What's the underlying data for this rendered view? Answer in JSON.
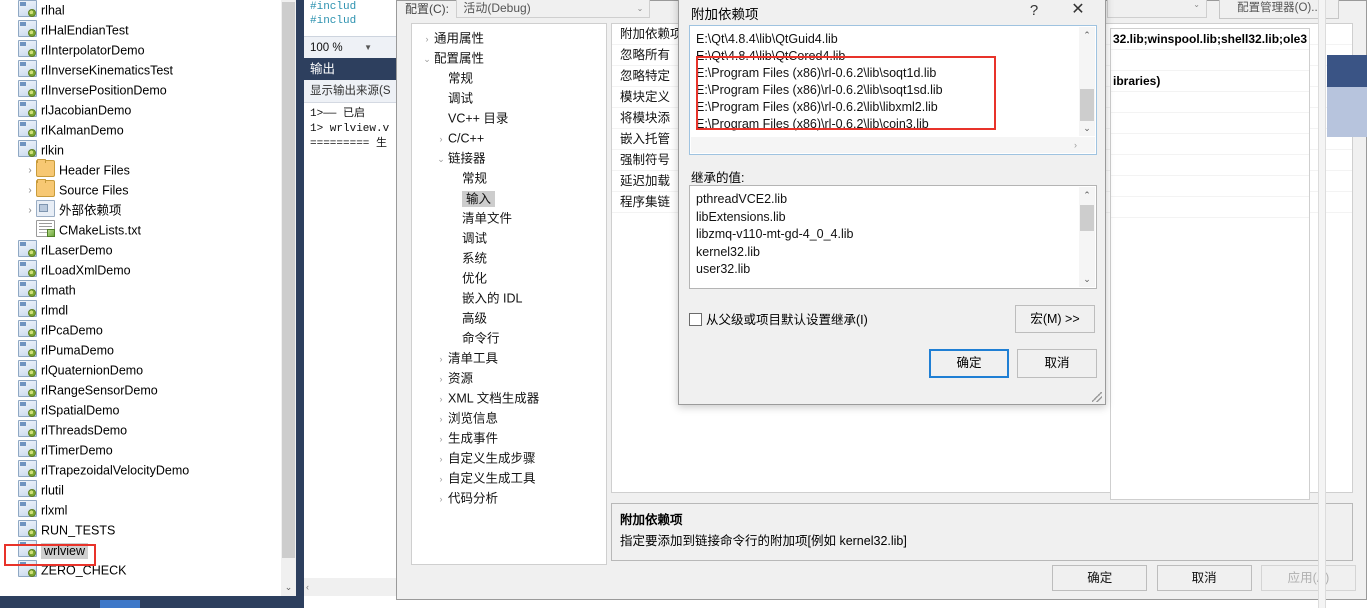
{
  "solution_explorer": {
    "items": [
      {
        "label": "rlhal",
        "icon": "project-icon",
        "indent": 1,
        "expander": "",
        "selected": false
      },
      {
        "label": "rlHalEndianTest",
        "icon": "project-icon",
        "indent": 1,
        "expander": "",
        "selected": false
      },
      {
        "label": "rlInterpolatorDemo",
        "icon": "project-icon",
        "indent": 1,
        "expander": "",
        "selected": false
      },
      {
        "label": "rlInverseKinematicsTest",
        "icon": "project-icon",
        "indent": 1,
        "expander": "",
        "selected": false
      },
      {
        "label": "rlInversePositionDemo",
        "icon": "project-icon",
        "indent": 1,
        "expander": "",
        "selected": false
      },
      {
        "label": "rlJacobianDemo",
        "icon": "project-icon",
        "indent": 1,
        "expander": "",
        "selected": false
      },
      {
        "label": "rlKalmanDemo",
        "icon": "project-icon",
        "indent": 1,
        "expander": "",
        "selected": false
      },
      {
        "label": "rlkin",
        "icon": "project-icon",
        "indent": 1,
        "expander": "",
        "selected": false
      },
      {
        "label": "Header Files",
        "icon": "folder-icon",
        "indent": 2,
        "expander": "›",
        "selected": false
      },
      {
        "label": "Source Files",
        "icon": "folder-icon",
        "indent": 2,
        "expander": "›",
        "selected": false
      },
      {
        "label": "外部依赖项",
        "icon": "external-dependencies-icon",
        "indent": 2,
        "expander": "›",
        "selected": false
      },
      {
        "label": "CMakeLists.txt",
        "icon": "text-file-icon",
        "indent": 2,
        "expander": "",
        "selected": false
      },
      {
        "label": "rlLaserDemo",
        "icon": "project-icon",
        "indent": 1,
        "expander": "",
        "selected": false
      },
      {
        "label": "rlLoadXmlDemo",
        "icon": "project-icon",
        "indent": 1,
        "expander": "",
        "selected": false
      },
      {
        "label": "rlmath",
        "icon": "project-icon",
        "indent": 1,
        "expander": "",
        "selected": false
      },
      {
        "label": "rlmdl",
        "icon": "project-icon",
        "indent": 1,
        "expander": "",
        "selected": false
      },
      {
        "label": "rlPcaDemo",
        "icon": "project-icon",
        "indent": 1,
        "expander": "",
        "selected": false
      },
      {
        "label": "rlPumaDemo",
        "icon": "project-icon",
        "indent": 1,
        "expander": "",
        "selected": false
      },
      {
        "label": "rlQuaternionDemo",
        "icon": "project-icon",
        "indent": 1,
        "expander": "",
        "selected": false
      },
      {
        "label": "rlRangeSensorDemo",
        "icon": "project-icon",
        "indent": 1,
        "expander": "",
        "selected": false
      },
      {
        "label": "rlSpatialDemo",
        "icon": "project-icon",
        "indent": 1,
        "expander": "",
        "selected": false
      },
      {
        "label": "rlThreadsDemo",
        "icon": "project-icon",
        "indent": 1,
        "expander": "",
        "selected": false
      },
      {
        "label": "rlTimerDemo",
        "icon": "project-icon",
        "indent": 1,
        "expander": "",
        "selected": false
      },
      {
        "label": "rlTrapezoidalVelocityDemo",
        "icon": "project-icon",
        "indent": 1,
        "expander": "",
        "selected": false
      },
      {
        "label": "rlutil",
        "icon": "project-icon",
        "indent": 1,
        "expander": "",
        "selected": false
      },
      {
        "label": "rlxml",
        "icon": "project-icon",
        "indent": 1,
        "expander": "",
        "selected": false
      },
      {
        "label": "RUN_TESTS",
        "icon": "project-icon",
        "indent": 1,
        "expander": "",
        "selected": false
      },
      {
        "label": "wrlview",
        "icon": "project-icon",
        "indent": 1,
        "expander": "",
        "selected": true
      },
      {
        "label": "ZERO_CHECK",
        "icon": "project-icon",
        "indent": 1,
        "expander": "",
        "selected": false
      }
    ],
    "scroll_down_glyph": "⌄"
  },
  "code_editor": {
    "lines": [
      "#includ",
      "#includ"
    ],
    "zoom_level": "100 %",
    "zoom_caret": "▼"
  },
  "output_window": {
    "title": "输出",
    "source_label": "显示输出来源(S",
    "lines": [
      "1>—— 已启",
      "1>  wrlview.v",
      "  =========  生"
    ],
    "hscroll_left_glyph": "‹"
  },
  "property_pages": {
    "config_label": "配置(C):",
    "config_value": "活动(Debug)",
    "platform_value": "",
    "config_manager_button": "配置管理器(O)...",
    "caret_glyph": "⌄",
    "tree": [
      {
        "label": "通用属性",
        "level": 0,
        "chev": "›",
        "selected": false
      },
      {
        "label": "配置属性",
        "level": 0,
        "chev": "⌄",
        "selected": false
      },
      {
        "label": "常规",
        "level": 1,
        "chev": "",
        "selected": false
      },
      {
        "label": "调试",
        "level": 1,
        "chev": "",
        "selected": false
      },
      {
        "label": "VC++ 目录",
        "level": 1,
        "chev": "",
        "selected": false
      },
      {
        "label": "C/C++",
        "level": 1,
        "chev": "›",
        "selected": false
      },
      {
        "label": "链接器",
        "level": 1,
        "chev": "⌄",
        "selected": false
      },
      {
        "label": "常规",
        "level": 2,
        "chev": "",
        "selected": false
      },
      {
        "label": "输入",
        "level": 2,
        "chev": "",
        "selected": true
      },
      {
        "label": "清单文件",
        "level": 2,
        "chev": "",
        "selected": false
      },
      {
        "label": "调试",
        "level": 2,
        "chev": "",
        "selected": false
      },
      {
        "label": "系统",
        "level": 2,
        "chev": "",
        "selected": false
      },
      {
        "label": "优化",
        "level": 2,
        "chev": "",
        "selected": false
      },
      {
        "label": "嵌入的 IDL",
        "level": 2,
        "chev": "",
        "selected": false
      },
      {
        "label": "高级",
        "level": 2,
        "chev": "",
        "selected": false
      },
      {
        "label": "命令行",
        "level": 2,
        "chev": "",
        "selected": false
      },
      {
        "label": "清单工具",
        "level": 1,
        "chev": "›",
        "selected": false
      },
      {
        "label": "资源",
        "level": 1,
        "chev": "›",
        "selected": false
      },
      {
        "label": "XML 文档生成器",
        "level": 1,
        "chev": "›",
        "selected": false
      },
      {
        "label": "浏览信息",
        "level": 1,
        "chev": "›",
        "selected": false
      },
      {
        "label": "生成事件",
        "level": 1,
        "chev": "›",
        "selected": false
      },
      {
        "label": "自定义生成步骤",
        "level": 1,
        "chev": "›",
        "selected": false
      },
      {
        "label": "自定义生成工具",
        "level": 1,
        "chev": "›",
        "selected": false
      },
      {
        "label": "代码分析",
        "level": 1,
        "chev": "›",
        "selected": false
      }
    ],
    "properties": [
      {
        "name": "附加依赖项",
        "value": "32.lib;winspool.lib;shell32.lib;ole3"
      },
      {
        "name": "忽略所有",
        "value": ""
      },
      {
        "name": "忽略特定",
        "value": "ibraries)"
      },
      {
        "name": "模块定义",
        "value": ""
      },
      {
        "name": "将模块添",
        "value": ""
      },
      {
        "name": "嵌入托管",
        "value": ""
      },
      {
        "name": "强制符号",
        "value": ""
      },
      {
        "name": "延迟加载",
        "value": ""
      },
      {
        "name": "程序集链",
        "value": ""
      }
    ],
    "description": {
      "title": "附加依赖项",
      "text": "指定要添加到链接命令行的附加项[例如 kernel32.lib]"
    },
    "buttons": {
      "ok": "确定",
      "cancel": "取消",
      "apply": "应用(A)"
    }
  },
  "additional_dependencies_dialog": {
    "title": "附加依赖项",
    "help_glyph": "?",
    "close_glyph": "✕",
    "edit_lines": [
      "E:\\Qt\\4.8.4\\lib\\QtGuid4.lib",
      "E:\\Qt\\4.8.4\\lib\\QtCored4.lib",
      "E:\\Program Files (x86)\\rl-0.6.2\\lib\\soqt1d.lib",
      "E:\\Program Files (x86)\\rl-0.6.2\\lib\\soqt1sd.lib",
      "E:\\Program Files (x86)\\rl-0.6.2\\lib\\libxml2.lib",
      "E:\\Program Files (x86)\\rl-0.6.2\\lib\\coin3.lib"
    ],
    "inherited_label": "继承的值:",
    "inherited_values": [
      "pthreadVCE2.lib",
      "libExtensions.lib",
      "libzmq-v110-mt-gd-4_0_4.lib",
      "kernel32.lib",
      "user32.lib"
    ],
    "inherit_checkbox_label": "从父级或项目默认设置继承(I)",
    "inherit_checked": false,
    "macro_button": "宏(M) >>",
    "ok_button": "确定",
    "cancel_button": "取消",
    "scroll_up_glyph": "⌃",
    "scroll_down_glyph": "⌄",
    "hscroll_right_glyph": "›"
  },
  "colors": {
    "highlight_red": "#e8332a",
    "focus_blue": "#1f7fd4",
    "ide_chrome": "#2d3f5e"
  }
}
